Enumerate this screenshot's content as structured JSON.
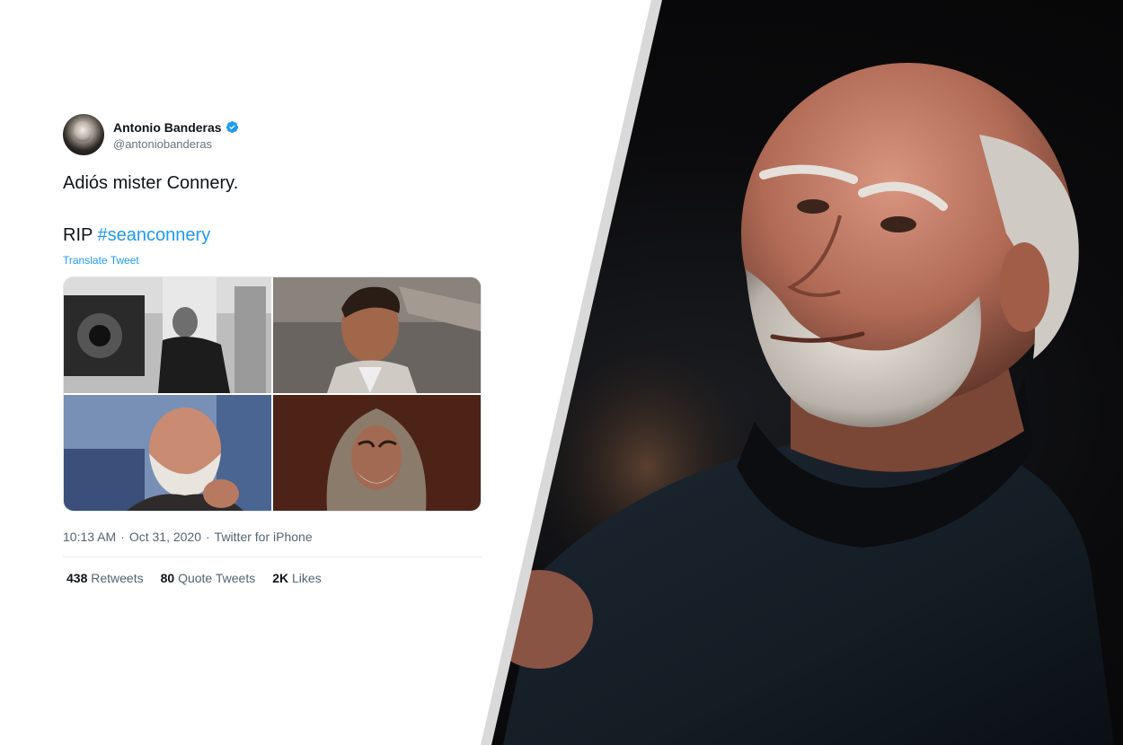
{
  "tweet": {
    "author": {
      "display_name": "Antonio Banderas",
      "handle": "@antoniobanderas",
      "verified": true,
      "avatar_icon": "avatar-photo"
    },
    "text_line_1": "Adiós mister Connery.",
    "text_line_2_prefix": "RIP",
    "hashtag": "#seanconnery",
    "translate_label": "Translate Tweet",
    "media": [
      {
        "alt": "black-and-white film set photo"
      },
      {
        "alt": "portrait in suit"
      },
      {
        "alt": "smiling portrait with white beard"
      },
      {
        "alt": "portrait in hooded robe"
      }
    ],
    "time": "10:13 AM",
    "date": "Oct 31, 2020",
    "meta_sep_1": "·",
    "meta_sep_2": "·",
    "source": "Twitter for iPhone",
    "stats": [
      {
        "count": "438",
        "label": "Retweets"
      },
      {
        "count": "80",
        "label": "Quote Tweets"
      },
      {
        "count": "2K",
        "label": "Likes"
      }
    ]
  },
  "colors": {
    "link": "#1d9bf0",
    "text": "#0f1419",
    "secondary": "#536471",
    "divider": "#e6ecf0"
  },
  "photo": {
    "alt": "portrait photo of older man in dark turtleneck and jacket"
  }
}
